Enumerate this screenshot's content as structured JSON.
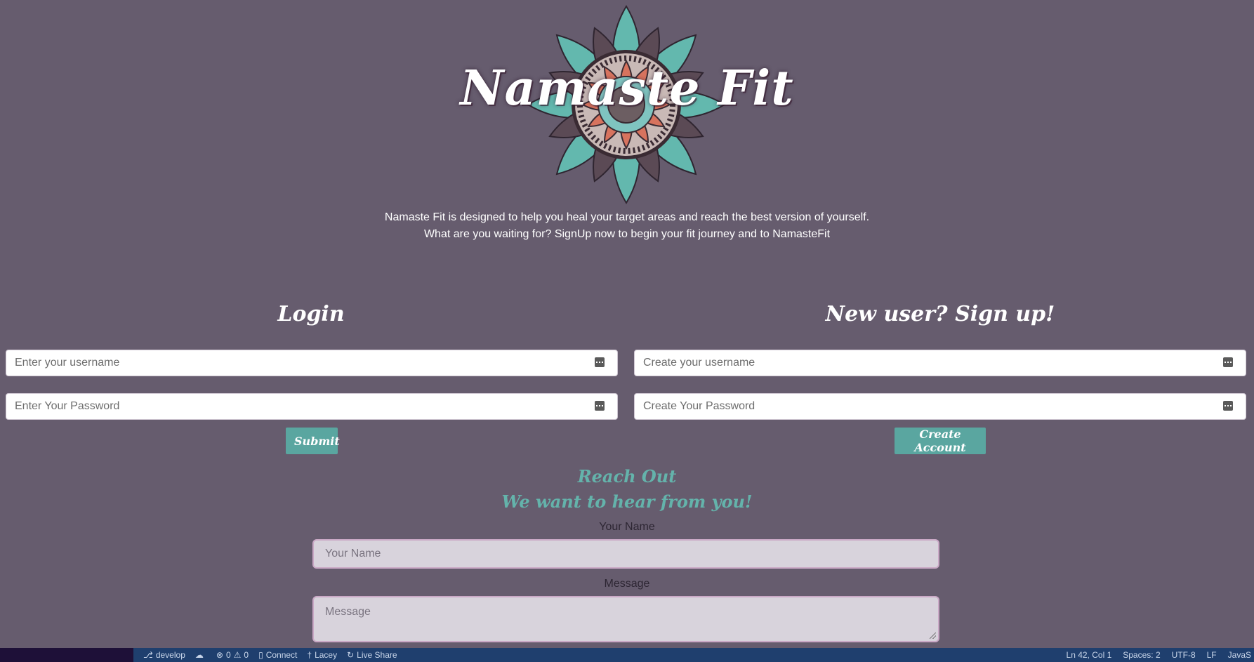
{
  "brand": {
    "title": "Namaste Fit",
    "intro_line1": "Namaste Fit is designed to help you heal your target areas and reach the best version of yourself.",
    "intro_line2": "What are you waiting for? SignUp now to begin your fit journey and to NamasteFit"
  },
  "login": {
    "title": "Login",
    "username_placeholder": "Enter your username",
    "password_placeholder": "Enter Your Password",
    "submit_label": "Submit"
  },
  "signup": {
    "title": "New user? Sign up!",
    "username_placeholder": "Create your username",
    "password_placeholder": "Create Your Password",
    "submit_label": "Create Account"
  },
  "contact": {
    "heading1": "Reach Out",
    "heading2": "We want to hear from you!",
    "name_label": "Your Name",
    "name_placeholder": "Your Name",
    "message_label": "Message",
    "message_placeholder": "Message"
  },
  "statusbar": {
    "branch": "develop",
    "errors": "0",
    "warnings": "0",
    "connect": "Connect",
    "user": "Lacey",
    "live_share": "Live Share",
    "position": "Ln 42, Col 1",
    "spaces": "Spaces: 2",
    "encoding": "UTF-8",
    "eol": "LF",
    "language": "JavaS"
  },
  "colors": {
    "page_bg": "#665c6e",
    "accent_teal": "#5aa6a0",
    "heading_teal": "#64b3ab",
    "statusbar_bg": "#1f3f6e"
  },
  "icons": [
    "mandala-logo",
    "password-key-icon",
    "git-branch-icon",
    "sync-icon",
    "error-icon",
    "warning-icon",
    "connect-icon",
    "user-icon",
    "live-share-icon"
  ]
}
